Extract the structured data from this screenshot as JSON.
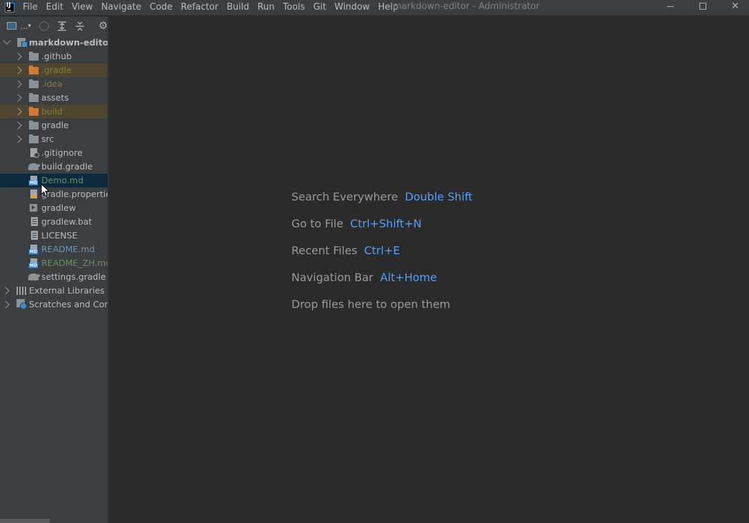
{
  "window": {
    "title": "markdown-editor - Administrator",
    "menu": [
      "File",
      "Edit",
      "View",
      "Navigate",
      "Code",
      "Refactor",
      "Build",
      "Run",
      "Tools",
      "Git",
      "Window",
      "Help"
    ]
  },
  "project_toolbar": {
    "view_selector_label": "..."
  },
  "tree": {
    "root": "markdown-editor",
    "items": [
      {
        "label": ".github",
        "kind": "folder"
      },
      {
        "label": ".gradle",
        "kind": "folder-excluded"
      },
      {
        "label": ".idea",
        "kind": "folder-ignored"
      },
      {
        "label": "assets",
        "kind": "folder"
      },
      {
        "label": "build",
        "kind": "folder-excluded"
      },
      {
        "label": "gradle",
        "kind": "folder"
      },
      {
        "label": "src",
        "kind": "folder"
      },
      {
        "label": ".gitignore",
        "kind": "file-ignore"
      },
      {
        "label": "build.gradle",
        "kind": "file-gradle"
      },
      {
        "label": "Demo.md",
        "kind": "file-md-added"
      },
      {
        "label": "gradle.properties",
        "kind": "file-props"
      },
      {
        "label": "gradlew",
        "kind": "file-exec"
      },
      {
        "label": "gradlew.bat",
        "kind": "file-text"
      },
      {
        "label": "LICENSE",
        "kind": "file-text"
      },
      {
        "label": "README.md",
        "kind": "file-md-modified"
      },
      {
        "label": "README_ZH.md",
        "kind": "file-md-added"
      },
      {
        "label": "settings.gradle",
        "kind": "file-gradle"
      }
    ],
    "external_libraries": "External Libraries",
    "scratches": "Scratches and Consoles"
  },
  "editor_hints": [
    {
      "action": "Search Everywhere",
      "shortcut": "Double Shift"
    },
    {
      "action": "Go to File",
      "shortcut": "Ctrl+Shift+N"
    },
    {
      "action": "Recent Files",
      "shortcut": "Ctrl+E"
    },
    {
      "action": "Navigation Bar",
      "shortcut": "Alt+Home"
    },
    {
      "action": "Drop files here to open them",
      "shortcut": ""
    }
  ],
  "colors": {
    "accent_shortcut": "#589df6",
    "excluded_folder": "#d07a38",
    "added_file": "#629755",
    "modified_file": "#6897bb",
    "selection": "#0d293e"
  }
}
